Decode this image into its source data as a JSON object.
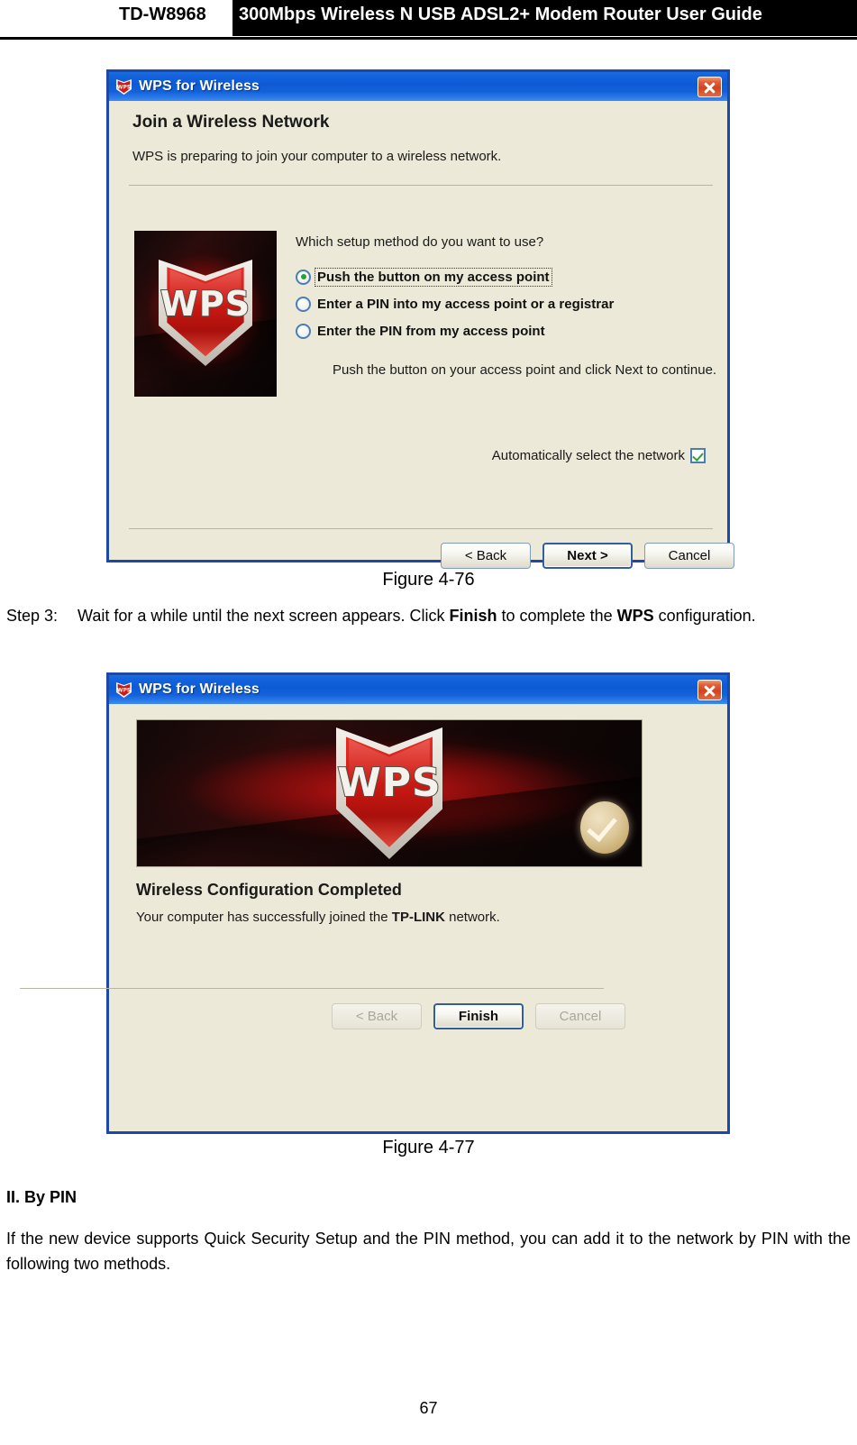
{
  "header": {
    "model": "TD-W8968",
    "title": "300Mbps Wireless N USB ADSL2+ Modem Router User Guide"
  },
  "dialog_one": {
    "window_title": "WPS for Wireless",
    "icon": "wps-shield-icon",
    "close_icon": "close-icon",
    "heading": "Join a Wireless Network",
    "subtitle": "WPS is preparing to join your computer to a wireless network.",
    "artwork_label": "WPS",
    "question": "Which setup method do you want to use?",
    "options": [
      {
        "label": "Push the button on my access point",
        "selected": true,
        "focused": true
      },
      {
        "label": "Enter a PIN into my access point or a registrar",
        "selected": false,
        "focused": false
      },
      {
        "label": "Enter the PIN from my access point",
        "selected": false,
        "focused": false
      }
    ],
    "hint": "Push the button on your access point and click Next to continue.",
    "auto_select_label": "Automatically select the network",
    "auto_select_checked": true,
    "buttons": [
      {
        "label": "< Back",
        "state": "normal"
      },
      {
        "label": "Next >",
        "state": "focused"
      },
      {
        "label": "Cancel",
        "state": "normal"
      }
    ]
  },
  "figure_one_caption": "Figure 4-76",
  "step_three": {
    "label": "Step 3:",
    "text_part1": "Wait for a while until the next screen appears. Click ",
    "bold1": "Finish",
    "text_part2": " to complete the ",
    "bold2": "WPS",
    "text_part3": " configuration."
  },
  "dialog_two": {
    "window_title": "WPS for Wireless",
    "icon": "wps-shield-icon",
    "close_icon": "close-icon",
    "artwork_label": "WPS",
    "badge_icon": "success-check-icon",
    "heading": "Wireless Configuration Completed",
    "sub_part1": "Your computer has successfully joined the ",
    "sub_bold": "TP-LINK",
    "sub_part2": " network.",
    "buttons": [
      {
        "label": "< Back",
        "state": "disabled"
      },
      {
        "label": "Finish",
        "state": "focused"
      },
      {
        "label": "Cancel",
        "state": "disabled"
      }
    ]
  },
  "figure_two_caption": "Figure 4-77",
  "section": {
    "heading": "II. By PIN",
    "paragraph": "If the new device supports Quick Security Setup and the PIN method, you can add it to the network by PIN with the following two methods."
  },
  "page_number": "67",
  "colors": {
    "titlebar_blue": "#0d5ad6",
    "dialog_border": "#1c49a8",
    "dialog_face": "#ece9d8",
    "close_red": "#d3431f",
    "radio_green": "#22a62c",
    "shield_red": "#cf1a14",
    "badge_tan": "#ddc99c"
  }
}
